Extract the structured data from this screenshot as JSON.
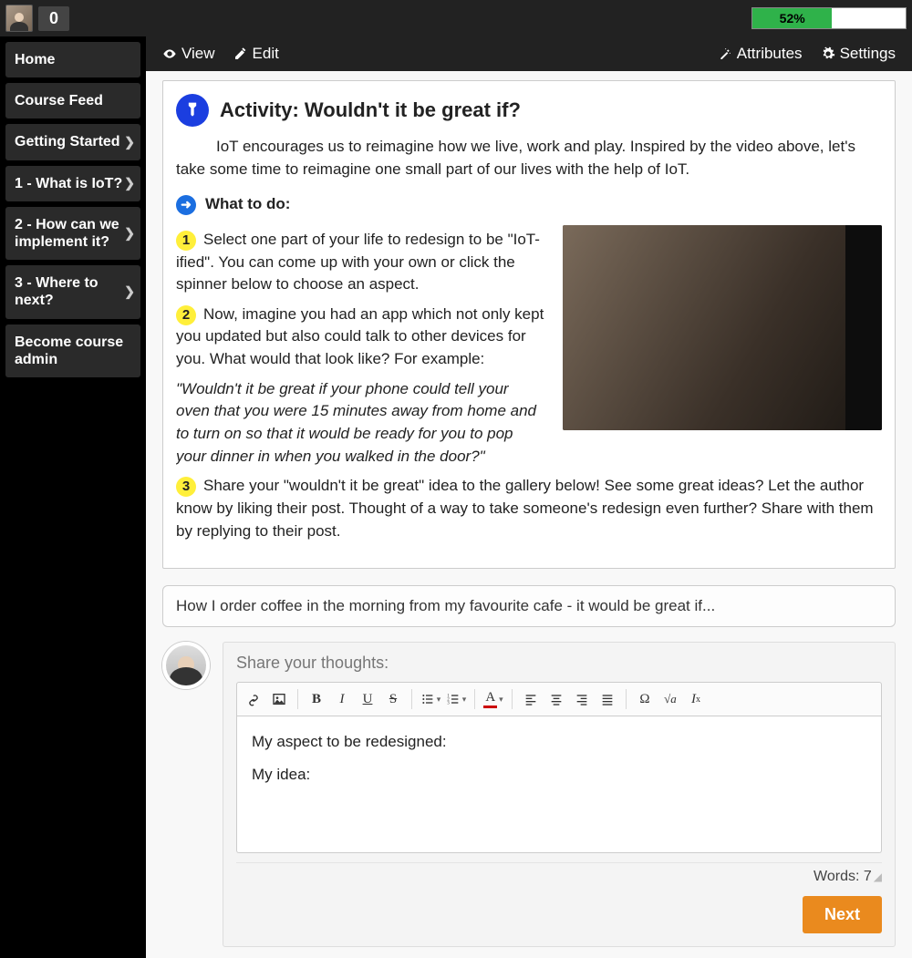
{
  "topbar": {
    "count": "0",
    "progress_percent": 52,
    "progress_label": "52%"
  },
  "sidebar": {
    "items": [
      {
        "label": "Home",
        "chevron": false
      },
      {
        "label": "Course Feed",
        "chevron": false
      },
      {
        "label": "Getting Started",
        "chevron": true
      },
      {
        "label": "1 - What is IoT?",
        "chevron": true
      },
      {
        "label": "2 - How can we implement it?",
        "chevron": true
      },
      {
        "label": "3 - Where to next?",
        "chevron": true
      },
      {
        "label": "Become course admin",
        "chevron": false
      }
    ]
  },
  "tabs": {
    "view": "View",
    "edit": "Edit",
    "attributes": "Attributes",
    "settings": "Settings"
  },
  "activity": {
    "title": "Activity: Wouldn't it be great if?",
    "intro": "IoT encourages us to reimagine how we live, work and play. Inspired by the video above, let's take some time to reimagine one small part of our lives with the help of IoT.",
    "what_to_do_label": "What to do:",
    "steps": [
      "Select one part of your life to redesign to be \"IoT-ified\". You can come up with your own or click the spinner below to choose an aspect.",
      "Now, imagine you had an app which not only kept you updated but also could talk to other devices for you. What would that look like? For example:",
      "Share your \"wouldn't it be great\" idea to the gallery below! See some great ideas? Let the author know by liking their post. Thought of a way to take someone's redesign even further? Share with them by replying to their post."
    ],
    "quote": "\"Wouldn't it be great if your phone could tell your oven that you were 15 minutes away from home and to turn on so that it would be ready for you to pop your dinner in when you walked in the door?\""
  },
  "prompt_line": "How I order coffee in the morning from my favourite cafe - it would be great if...",
  "composer": {
    "title": "Share your thoughts:",
    "body_lines": [
      "My aspect to be redesigned:",
      "My idea:"
    ],
    "word_label": "Words: ",
    "word_count": "7",
    "next": "Next"
  },
  "toolbar_icons": [
    "link-icon",
    "image-icon",
    "bold-icon",
    "italic-icon",
    "underline-icon",
    "strike-icon",
    "bulleted-list-icon",
    "numbered-list-icon",
    "text-color-icon",
    "align-left-icon",
    "align-center-icon",
    "align-right-icon",
    "align-justify-icon",
    "omega-icon",
    "sqrt-icon",
    "clear-format-icon"
  ]
}
